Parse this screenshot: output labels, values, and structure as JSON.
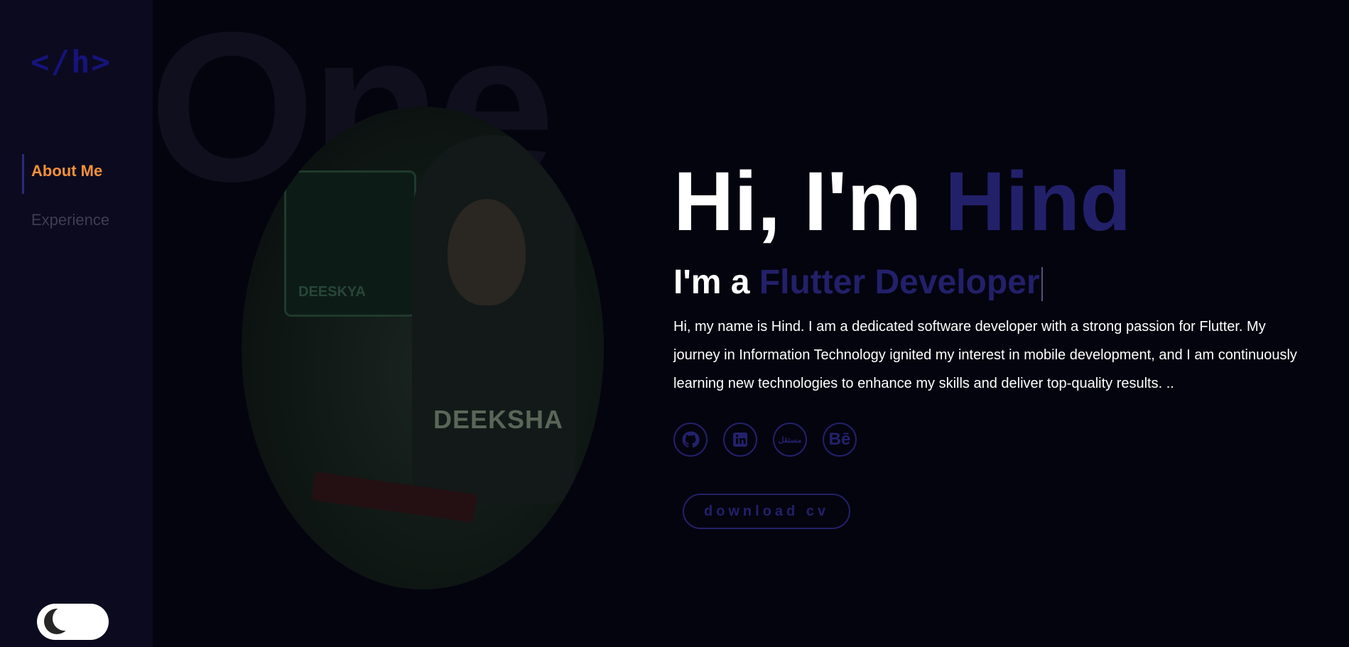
{
  "logo": "</h>",
  "nav": {
    "items": [
      {
        "label": "About Me",
        "active": true
      },
      {
        "label": "Experience",
        "active": false
      }
    ]
  },
  "background_word": "One",
  "portrait": {
    "shirt_text": "DEEKSHA",
    "screen_label": "DEESKYA"
  },
  "hero": {
    "greeting": "Hi, I'm",
    "name": "Hind",
    "role_prefix": "I'm a",
    "role": "Flutter Developer",
    "description": "Hi, my name is Hind. I am a dedicated software developer with a strong passion for Flutter. My journey in Information Technology ignited my interest in mobile development, and I am continuously learning new technologies to enhance my skills and deliver top-quality results. .."
  },
  "socials": [
    {
      "name": "github-icon"
    },
    {
      "name": "linkedin-icon"
    },
    {
      "name": "mostaql-icon",
      "label": "مستقل"
    },
    {
      "name": "behance-icon",
      "label": "Bē"
    }
  ],
  "download_cv": "download cv",
  "colors": {
    "accent": "#23206a",
    "active_nav": "#f2913a",
    "background": "#04040f",
    "sidebar": "#0b0a1f"
  },
  "theme_toggle": {
    "mode": "dark"
  }
}
